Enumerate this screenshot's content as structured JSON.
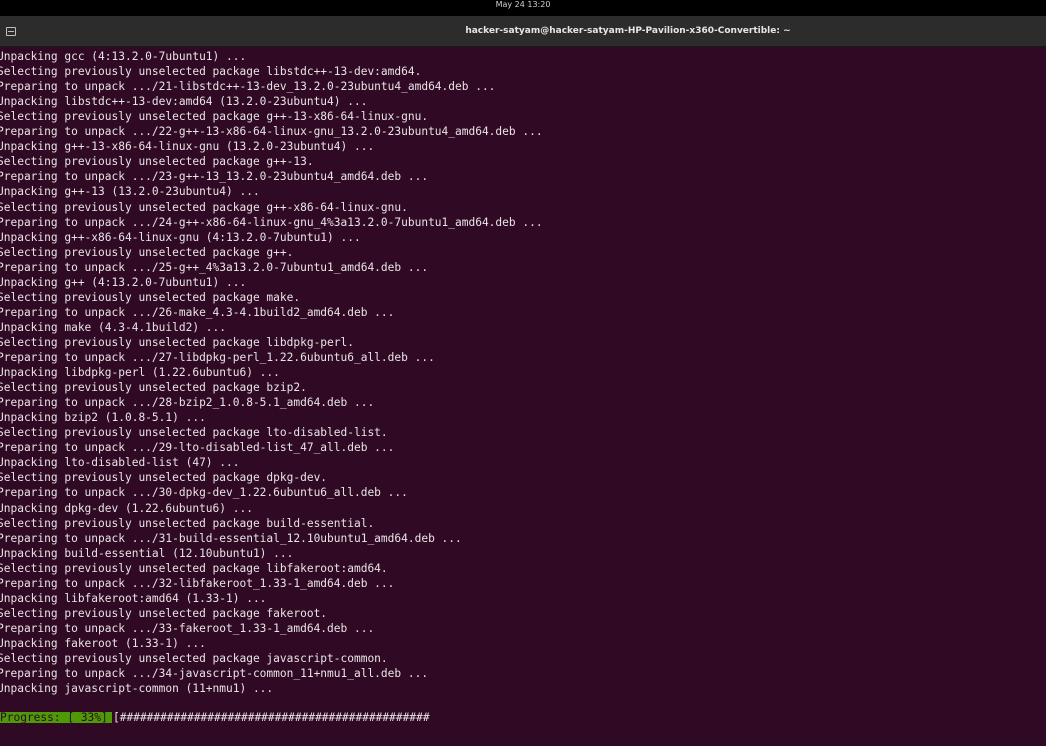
{
  "topbar": {
    "clock": "May 24  13:20"
  },
  "window": {
    "title": "hacker-satyam@hacker-satyam-HP-Pavilion-x360-Convertible: ~"
  },
  "terminal": {
    "lines": [
      "Unpacking gcc (4:13.2.0-7ubuntu1) ...",
      "Selecting previously unselected package libstdc++-13-dev:amd64.",
      "Preparing to unpack .../21-libstdc++-13-dev_13.2.0-23ubuntu4_amd64.deb ...",
      "Unpacking libstdc++-13-dev:amd64 (13.2.0-23ubuntu4) ...",
      "Selecting previously unselected package g++-13-x86-64-linux-gnu.",
      "Preparing to unpack .../22-g++-13-x86-64-linux-gnu_13.2.0-23ubuntu4_amd64.deb ...",
      "Unpacking g++-13-x86-64-linux-gnu (13.2.0-23ubuntu4) ...",
      "Selecting previously unselected package g++-13.",
      "Preparing to unpack .../23-g++-13_13.2.0-23ubuntu4_amd64.deb ...",
      "Unpacking g++-13 (13.2.0-23ubuntu4) ...",
      "Selecting previously unselected package g++-x86-64-linux-gnu.",
      "Preparing to unpack .../24-g++-x86-64-linux-gnu_4%3a13.2.0-7ubuntu1_amd64.deb ...",
      "Unpacking g++-x86-64-linux-gnu (4:13.2.0-7ubuntu1) ...",
      "Selecting previously unselected package g++.",
      "Preparing to unpack .../25-g++_4%3a13.2.0-7ubuntu1_amd64.deb ...",
      "Unpacking g++ (4:13.2.0-7ubuntu1) ...",
      "Selecting previously unselected package make.",
      "Preparing to unpack .../26-make_4.3-4.1build2_amd64.deb ...",
      "Unpacking make (4.3-4.1build2) ...",
      "Selecting previously unselected package libdpkg-perl.",
      "Preparing to unpack .../27-libdpkg-perl_1.22.6ubuntu6_all.deb ...",
      "Unpacking libdpkg-perl (1.22.6ubuntu6) ...",
      "Selecting previously unselected package bzip2.",
      "Preparing to unpack .../28-bzip2_1.0.8-5.1_amd64.deb ...",
      "Unpacking bzip2 (1.0.8-5.1) ...",
      "Selecting previously unselected package lto-disabled-list.",
      "Preparing to unpack .../29-lto-disabled-list_47_all.deb ...",
      "Unpacking lto-disabled-list (47) ...",
      "Selecting previously unselected package dpkg-dev.",
      "Preparing to unpack .../30-dpkg-dev_1.22.6ubuntu6_all.deb ...",
      "Unpacking dpkg-dev (1.22.6ubuntu6) ...",
      "Selecting previously unselected package build-essential.",
      "Preparing to unpack .../31-build-essential_12.10ubuntu1_amd64.deb ...",
      "Unpacking build-essential (12.10ubuntu1) ...",
      "Selecting previously unselected package libfakeroot:amd64.",
      "Preparing to unpack .../32-libfakeroot_1.33-1_amd64.deb ...",
      "Unpacking libfakeroot:amd64 (1.33-1) ...",
      "Selecting previously unselected package fakeroot.",
      "Preparing to unpack .../33-fakeroot_1.33-1_amd64.deb ...",
      "Unpacking fakeroot (1.33-1) ...",
      "Selecting previously unselected package javascript-common.",
      "Preparing to unpack .../34-javascript-common_11+nmu1_all.deb ...",
      "Unpacking javascript-common (11+nmu1) ..."
    ]
  },
  "progress": {
    "label": "Progress: [ 33%]",
    "bar": "[##############################################"
  },
  "colors": {
    "terminal_bg": "#300a24",
    "terminal_fg": "#e8e4e6",
    "progress_label_bg": "#4e9a06",
    "titlebar_bg": "#2c2c2c"
  }
}
